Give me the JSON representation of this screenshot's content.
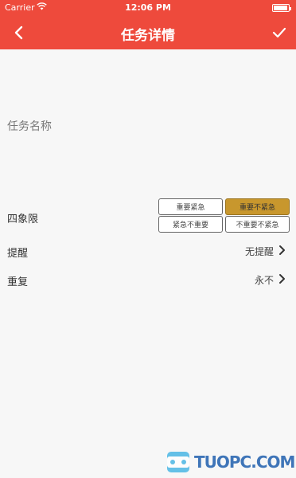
{
  "status_bar": {
    "carrier": "Carrier",
    "time": "12:06 PM"
  },
  "nav": {
    "title": "任务详情"
  },
  "task_name": {
    "placeholder": "任务名称",
    "value": ""
  },
  "quadrant": {
    "label": "四象限",
    "options": [
      "重要紧急",
      "重要不紧急",
      "紧急不重要",
      "不重要不紧急"
    ],
    "selected": "重要不紧急",
    "selected_color": "#c8972d"
  },
  "reminder": {
    "label": "提醒",
    "value": "无提醒"
  },
  "repeat": {
    "label": "重复",
    "value": "永不"
  },
  "theme": {
    "accent": "#ee4a3c"
  },
  "watermark": {
    "text": "TUOPC.COM"
  }
}
